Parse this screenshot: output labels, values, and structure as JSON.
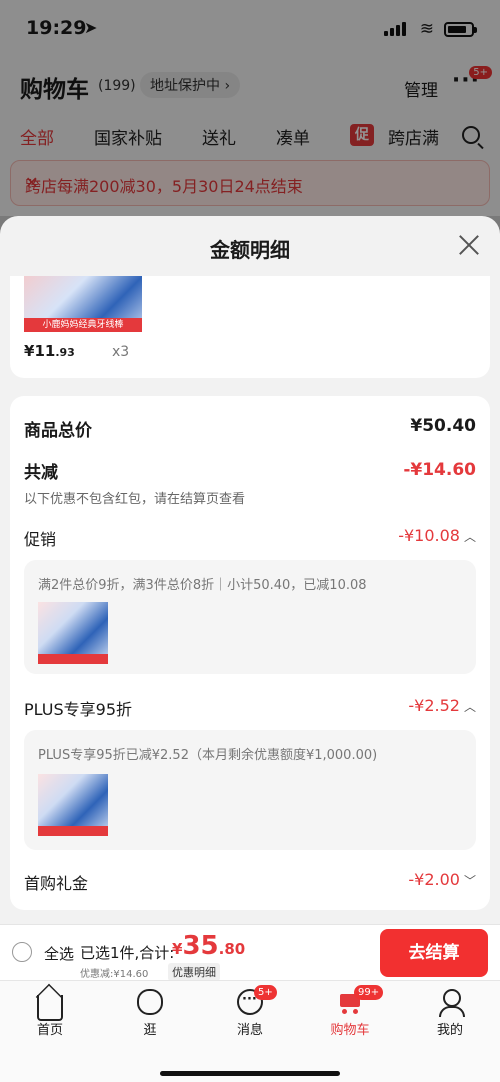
{
  "status_bar": {
    "time": "19:29",
    "location_glyph": "➤",
    "wifi_glyph": "≋"
  },
  "header": {
    "title": "购物车",
    "count": "(199)",
    "address": "地址保护中 ›",
    "manage": "管理",
    "more": "···",
    "more_badge": "5+"
  },
  "tabs": [
    {
      "label": "全部",
      "active": true
    },
    {
      "label": "国家补贴"
    },
    {
      "label": "送礼"
    },
    {
      "label": "凑单"
    },
    {
      "label": "跨店满"
    }
  ],
  "tab_tag": "促",
  "promo_banner": {
    "text": "跨店每满200减30，5月30日24点结束",
    "close": "✕"
  },
  "sheet": {
    "title": "金额明细",
    "item": {
      "image_caption": "小鹿妈妈经典牙线棒",
      "price_symbol": "¥",
      "price_int": "11",
      "price_dec": ".93",
      "quantity": "x3"
    },
    "goods_total_label": "商品总价",
    "goods_total_value": "¥50.40",
    "reduction_label": "共减",
    "reduction_value": "-¥14.60",
    "reduction_note": "以下优惠不包含红包，请在结算页查看",
    "promo_label": "促销",
    "promo_value": "-¥10.08",
    "promo_detail": "满2件总价9折，满3件总价8折｜小计50.40，已减10.08",
    "plus_label": "PLUS专享95折",
    "plus_value": "-¥2.52",
    "plus_detail": "PLUS专享95折已减¥2.52（本月剩余优惠额度¥1,000.00)",
    "first_gift_label": "首购礼金",
    "first_gift_value": "-¥2.00",
    "chevron_up": "︿",
    "chevron_down": "﹀"
  },
  "checkout": {
    "select_all": "全选",
    "selected": "已选1件,合计:",
    "currency": "¥",
    "total_int": "35",
    "total_dec": ".80",
    "discount": "优惠减:¥14.60",
    "detail_link": "优惠明细",
    "pay_button": "去结算"
  },
  "tabbar": [
    {
      "label": "首页",
      "icon": "home-icon"
    },
    {
      "label": "逛",
      "icon": "browse-icon"
    },
    {
      "label": "消息",
      "icon": "message-icon",
      "badge": "5+"
    },
    {
      "label": "购物车",
      "icon": "cart-icon",
      "badge": "99+",
      "active": true
    },
    {
      "label": "我的",
      "icon": "profile-icon"
    }
  ],
  "colors": {
    "accent": "#e4393c",
    "pay_button": "#f23030"
  }
}
